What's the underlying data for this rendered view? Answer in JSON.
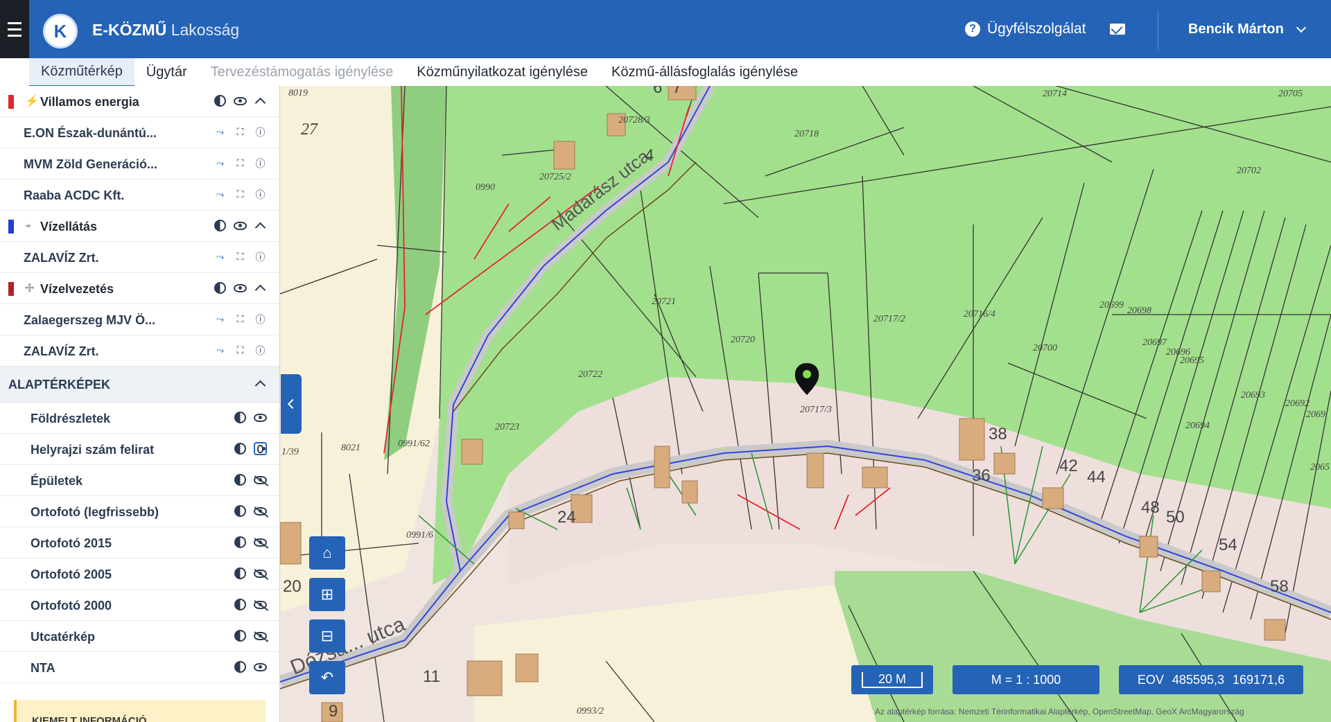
{
  "header": {
    "logo_letter": "K",
    "brand_bold": "E-KÖZMŰ",
    "brand_sub": "Lakosság",
    "help_label": "Ügyfélszolgálat",
    "user_name": "Bencik Márton"
  },
  "tabs": [
    {
      "label": "Közműtérkép",
      "state": "active"
    },
    {
      "label": "Ügytár",
      "state": "normal"
    },
    {
      "label": "Tervezéstámogatás igénylése",
      "state": "disabled"
    },
    {
      "label": "Közműnyilatkozat igénylése",
      "state": "normal"
    },
    {
      "label": "Közmű-állásfoglalás igénylése",
      "state": "normal"
    }
  ],
  "layers": {
    "groups": [
      {
        "name": "Villamos energia",
        "color": "#e3262a",
        "icon": "lightning-icon",
        "providers": [
          "E.ON Észak-dunántú...",
          "MVM Zöld Generáció...",
          "Raaba ACDC Kft."
        ]
      },
      {
        "name": "Vízellátás",
        "color": "#1f3fd1",
        "icon": "water-drop-icon",
        "providers": [
          "ZALAVÍZ Zrt."
        ]
      },
      {
        "name": "Vízelvezetés",
        "color": "#b32228",
        "icon": "drain-icon",
        "providers": [
          "Zalaegerszeg MJV Ö...",
          "ZALAVÍZ Zrt."
        ]
      }
    ]
  },
  "base_maps": {
    "title": "ALAPTÉRKÉPEK",
    "items": [
      {
        "label": "Földrészletek",
        "visible": true,
        "highlighted": false
      },
      {
        "label": "Helyrajzi szám felirat",
        "visible": true,
        "highlighted": true
      },
      {
        "label": "Épületek",
        "visible": false,
        "highlighted": false
      },
      {
        "label": "Ortofotó (legfrissebb)",
        "visible": false,
        "highlighted": false
      },
      {
        "label": "Ortofotó 2015",
        "visible": false,
        "highlighted": false
      },
      {
        "label": "Ortofotó 2005",
        "visible": false,
        "highlighted": false
      },
      {
        "label": "Ortofotó 2000",
        "visible": false,
        "highlighted": false
      },
      {
        "label": "Utcatérkép",
        "visible": false,
        "highlighted": false
      },
      {
        "label": "NTA",
        "visible": true,
        "highlighted": false
      }
    ]
  },
  "info_box": {
    "title": "KIEMELT INFORMÁCIÓ"
  },
  "map": {
    "street_names": [
      "Madarász utca",
      "Dózsa... utca"
    ],
    "parcel_labels": [
      "8019",
      "27",
      "20728/3",
      "20725/2",
      "20718",
      "20714",
      "20705",
      "20702",
      "0990",
      "20721",
      "20720",
      "20722",
      "20723",
      "20717/2",
      "20716/4",
      "20700",
      "20697",
      "20696",
      "20695",
      "20693",
      "20694",
      "20717/3",
      "20692",
      "0991/62",
      "8021",
      "1/39",
      "0991/6",
      "0993/2",
      "20699",
      "20698",
      "2069",
      "2065"
    ],
    "house_numbers": [
      "4",
      "7",
      "6",
      "24",
      "38",
      "36",
      "42",
      "44",
      "48",
      "50",
      "54",
      "58",
      "20",
      "11",
      "9"
    ],
    "scale_bar": "20 M",
    "scale_ratio": "M = 1 : 1000",
    "coords_label": "EOV",
    "coord_x": "485595,3",
    "coord_y": "169171,6",
    "attribution": "Az alaptérkép forrása: Nemzeti Térinformatikai Alaptérkép, OpenStreetMap, GeoX ArcMagyarország"
  }
}
